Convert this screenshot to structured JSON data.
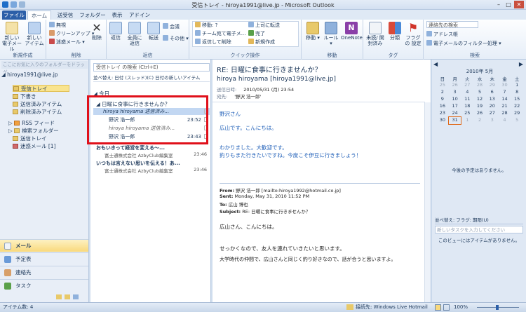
{
  "window": {
    "title": "受信トレイ - hiroya1991@live.jp - Microsoft Outlook"
  },
  "tabs": [
    "ファイル",
    "ホーム",
    "送受信",
    "フォルダー",
    "表示",
    "アドイン"
  ],
  "ribbon": {
    "new": {
      "email": "新しい 電子メール",
      "item": "新しい アイテム",
      "label": "新規作成"
    },
    "delete": {
      "ignore": "無視",
      "cleanup": "クリーンアップ",
      "junk": "迷惑メール",
      "delete": "削除",
      "label": "削除"
    },
    "respond": {
      "reply": "返信",
      "replyall": "全員に 返信",
      "forward": "転送",
      "meeting": "会議",
      "more": "その他",
      "label": "返信"
    },
    "quick": {
      "items": [
        "移動: ?",
        "チーム宛て電子メ...",
        "返信して削除",
        "上司に転送",
        "完了",
        "新規作成"
      ],
      "label": "クイック操作"
    },
    "move": {
      "move": "移動",
      "rules": "ルール",
      "onenote": "OneNote",
      "label": "移動"
    },
    "tags": {
      "unread": "未読/ 開封済み",
      "categorize": "分類",
      "followup": "フラグの 設定",
      "label": "タグ"
    },
    "find": {
      "search": "連絡先の検索",
      "addressbook": "アドレス帳",
      "filter": "電子メールのフィルター処理",
      "label": "検索"
    }
  },
  "nav": {
    "favorites": "ここにお気に入りのフォルダーをドラッグ",
    "account": "hiroya1991@live.jp",
    "folders": [
      "受信トレイ",
      "下書き",
      "送信済みアイテム",
      "削除済みアイテム",
      "RSS フィード",
      "検索フォルダー",
      "送信トレイ",
      "迷惑メール [1]"
    ],
    "buttons": [
      "メール",
      "予定表",
      "連絡先",
      "タスク"
    ]
  },
  "list": {
    "search_placeholder": "受信トレイ の検索 (Ctrl+E)",
    "sort": "並べ替え: 日付 (スレッド)(C)  日付の新しいアイテム",
    "group": "今日",
    "thread": "日曜に食事に行きませんか？",
    "rows": [
      {
        "from": "hiroya hiroyama 送信済み...",
        "date": ""
      },
      {
        "from": "野沢 浩一郎",
        "date": "23:52"
      },
      {
        "from": "hiroya hiroyama 送信済み...",
        "date": ""
      },
      {
        "from": "野沢 浩一郎",
        "date": "23:43"
      }
    ],
    "others": [
      {
        "subject": "おもいきって経営を変える～...",
        "sender": "富士通株式会社 AzbyClub編集室",
        "date": "23:46"
      },
      {
        "subject": "いつもは言えない思いを伝える！あ...",
        "sender": "富士通株式会社 AzbyClub編集室",
        "date": "23:46"
      }
    ]
  },
  "reading": {
    "subject": "RE: 日曜に食事に行きませんか？",
    "from": "hiroya hiroyama [hiroya1991@live.jp]",
    "sent_label": "送信日時:",
    "sent": "2010/05/31 (月) 23:54",
    "to_label": "宛先:",
    "to": "'野沢 浩一郎'",
    "body": [
      "野沢さん",
      "広山です。こんにちは。",
      "わかりました。大歓迎です。",
      "釣りもまた行きたいですね。今度こそ伊豆に行きましょう！"
    ],
    "quoted": {
      "from": "From:",
      "from_v": "野沢 浩一郎 [mailto:hiroya1992@hotmail.co.jp]",
      "sent": "Sent:",
      "sent_v": "Monday, May 31, 2010 11:52 PM",
      "to": "To:",
      "to_v": "広山 博也",
      "subject": "Subject:",
      "subject_v": "RE: 日曜に食事に行きませんか？",
      "body": [
        "広山さん、こんにちは。",
        "せっかくなので、友人を連れていきたいと思います。",
        "大学時代の仲間で、広山さんと同じく釣り好きなので、話が合うと思いますよ。"
      ]
    }
  },
  "todo": {
    "month": "2010年 5月",
    "weekdays": [
      "日",
      "月",
      "火",
      "水",
      "木",
      "金",
      "土"
    ],
    "weeks": [
      [
        "25",
        "26",
        "27",
        "28",
        "29",
        "30",
        "1"
      ],
      [
        "2",
        "3",
        "4",
        "5",
        "6",
        "7",
        "8"
      ],
      [
        "9",
        "10",
        "11",
        "12",
        "13",
        "14",
        "15"
      ],
      [
        "16",
        "17",
        "18",
        "19",
        "20",
        "21",
        "22"
      ],
      [
        "23",
        "24",
        "25",
        "26",
        "27",
        "28",
        "29"
      ],
      [
        "30",
        "31",
        "1",
        "2",
        "3",
        "4",
        "5"
      ]
    ],
    "no_appointments": "今後の予定はありません。",
    "task_sort": "並べ替え: フラグ: 期限(U)",
    "task_input": "新しいタスクを入力してください",
    "no_items": "このビューにはアイテムがありません。"
  },
  "status": {
    "items": "アイテム数: 4",
    "connection": "接続先: Windows Live Hotmail",
    "zoom": "100%"
  },
  "colors": {
    "accent": "#2c5fa8",
    "selected": "#c2d7f2",
    "highlight": "#e0101a"
  }
}
